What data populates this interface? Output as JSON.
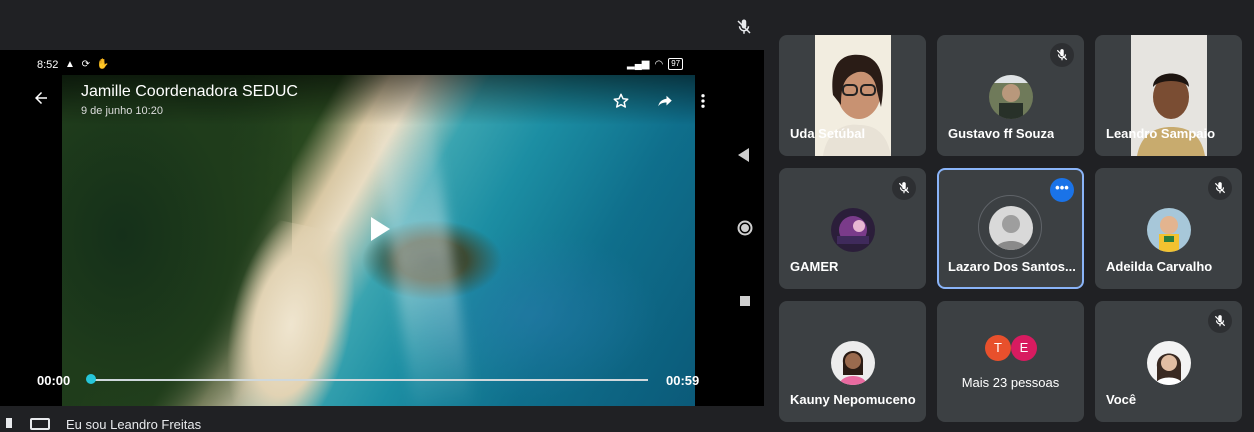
{
  "presentation": {
    "status_time": "8:52",
    "battery": "97",
    "video_title": "Jamille Coordenadora SEDUC",
    "video_date": "9 de junho 10:20",
    "time_current": "00:00",
    "time_total": "00:59",
    "progress": 0.0
  },
  "footer": {
    "label": "Eu sou Leandro Freitas"
  },
  "participants": [
    {
      "name": "Uda Setúbal"
    },
    {
      "name": "Gustavo ff Souza"
    },
    {
      "name": "Leandro Sampaio"
    },
    {
      "name": "GAMER"
    },
    {
      "name": "Lazaro Dos Santos..."
    },
    {
      "name": "Adeilda Carvalho"
    },
    {
      "name": "Kauny Nepomuceno"
    },
    {
      "name": "Você"
    }
  ],
  "more_people": {
    "label": "Mais 23 pessoas",
    "initials": [
      "T",
      "E"
    ],
    "colors": [
      "#e8502c",
      "#d81b60"
    ]
  },
  "colors": {
    "background": "#202124",
    "tile": "#3c4043",
    "active_border": "#8ab4f8",
    "accent": "#1a73e8"
  }
}
